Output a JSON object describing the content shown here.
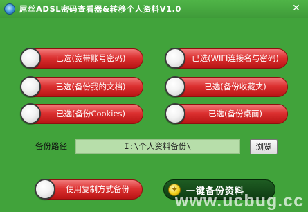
{
  "window": {
    "title": "屌丝ADSL密码查看器&转移个人资料V1.0",
    "minimize_glyph": "—",
    "close_glyph": "✕"
  },
  "options": [
    {
      "label": "已选(宽带账号密码)",
      "state": "selected"
    },
    {
      "label": "已选(WIFI连接名与密码)",
      "state": "selected"
    },
    {
      "label": "已选(备份我的文档)",
      "state": "selected"
    },
    {
      "label": "已选(备份收藏夹)",
      "state": "selected"
    },
    {
      "label": "已选(备份Cookies)",
      "state": "selected"
    },
    {
      "label": "已选(备份桌面)",
      "state": "selected"
    }
  ],
  "backup_path": {
    "label": "备份路径",
    "value": "I:\\个人资料备份\\",
    "browse_label": "浏览"
  },
  "copy_mode": {
    "label": "使用复制方式备份"
  },
  "onekey": {
    "label": "一键备份资料",
    "icon": "lightning-icon",
    "icon_glyph": "✦"
  },
  "watermark": "www.ucbug.cc",
  "colors": {
    "window_bg": "#41a33b",
    "pill_red": "#dc3131",
    "onekey_bg": "#1e5c22",
    "path_field_bg": "#b7deaa"
  }
}
